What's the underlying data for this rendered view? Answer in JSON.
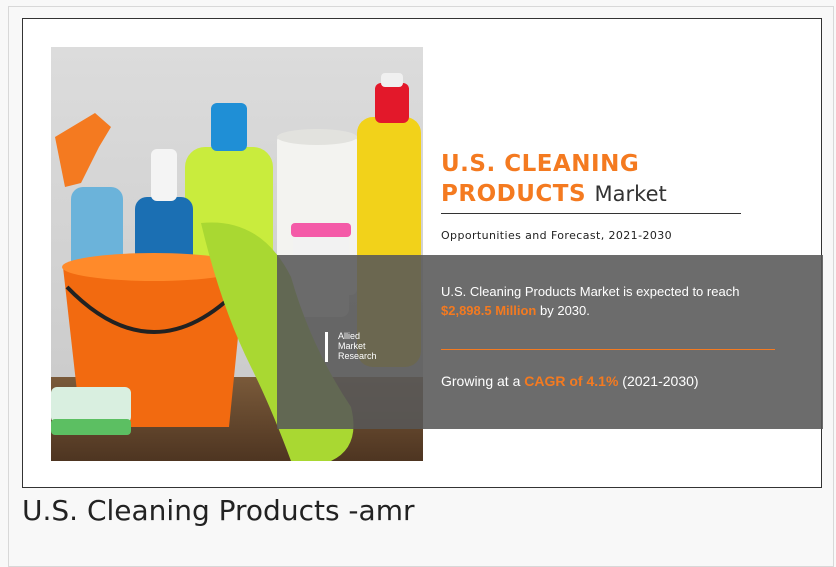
{
  "headline": {
    "line1": "U.S. CLEANING",
    "line2": "PRODUCTS",
    "line2_suffix": "Market"
  },
  "subtitle": "Opportunities and Forecast, 2021-2030",
  "statement": {
    "prefix": "U.S. Cleaning Products Market is expected to reach",
    "value": "$2,898.5 Million",
    "suffix": "by 2030."
  },
  "growth": {
    "prefix": "Growing at a",
    "value": "CAGR of 4.1%",
    "suffix": "(2021-2030)"
  },
  "logo": {
    "line1": "Allied",
    "line2": "Market",
    "line3": "Research"
  },
  "caption": "U.S. Cleaning Products -amr",
  "colors": {
    "accent": "#f47a20",
    "panel": "#585858"
  }
}
